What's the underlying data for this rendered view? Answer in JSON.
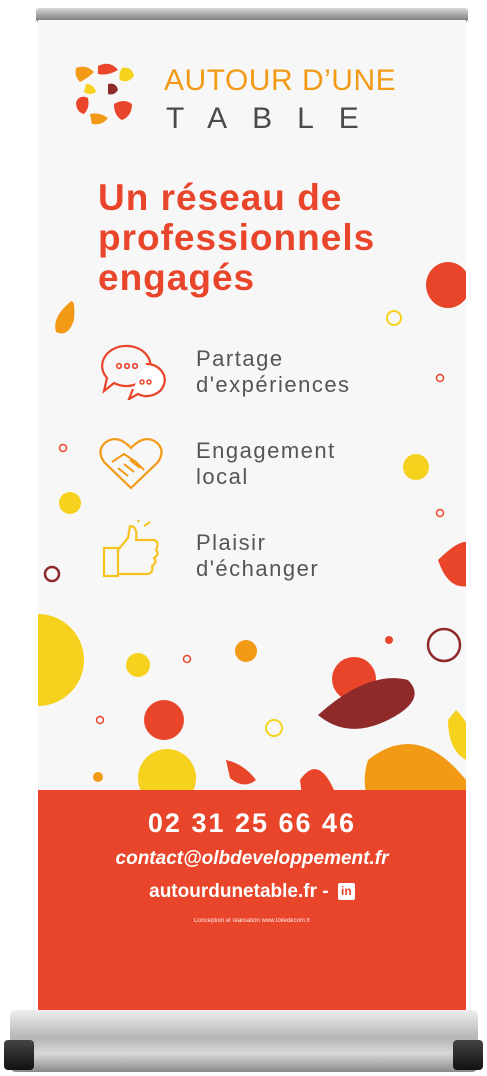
{
  "brand": {
    "line1": "AUTOUR D’UNE",
    "line2": "TABLE"
  },
  "headline": [
    "Un réseau de",
    "professionnels",
    "engagés"
  ],
  "features": [
    {
      "icon": "speech-bubbles-icon",
      "lines": [
        "Partage",
        "d'expériences"
      ]
    },
    {
      "icon": "handshake-heart-icon",
      "lines": [
        "Engagement",
        "local"
      ]
    },
    {
      "icon": "thumbs-up-icon",
      "lines": [
        "Plaisir",
        "d'échanger"
      ]
    }
  ],
  "contact": {
    "phone": "02 31 25 66 46",
    "email": "contact@olbdeveloppement.fr",
    "website": "autourdunetable.fr -",
    "linkedin_glyph": "in",
    "credit": "Conception et réalisation www.toiledecom.fr"
  },
  "colors": {
    "brand_red": "#e8452a",
    "brand_orange": "#f29a16",
    "brand_yellow": "#f6d21e",
    "dark_red": "#8e2a2a",
    "text_gray": "#555555"
  }
}
